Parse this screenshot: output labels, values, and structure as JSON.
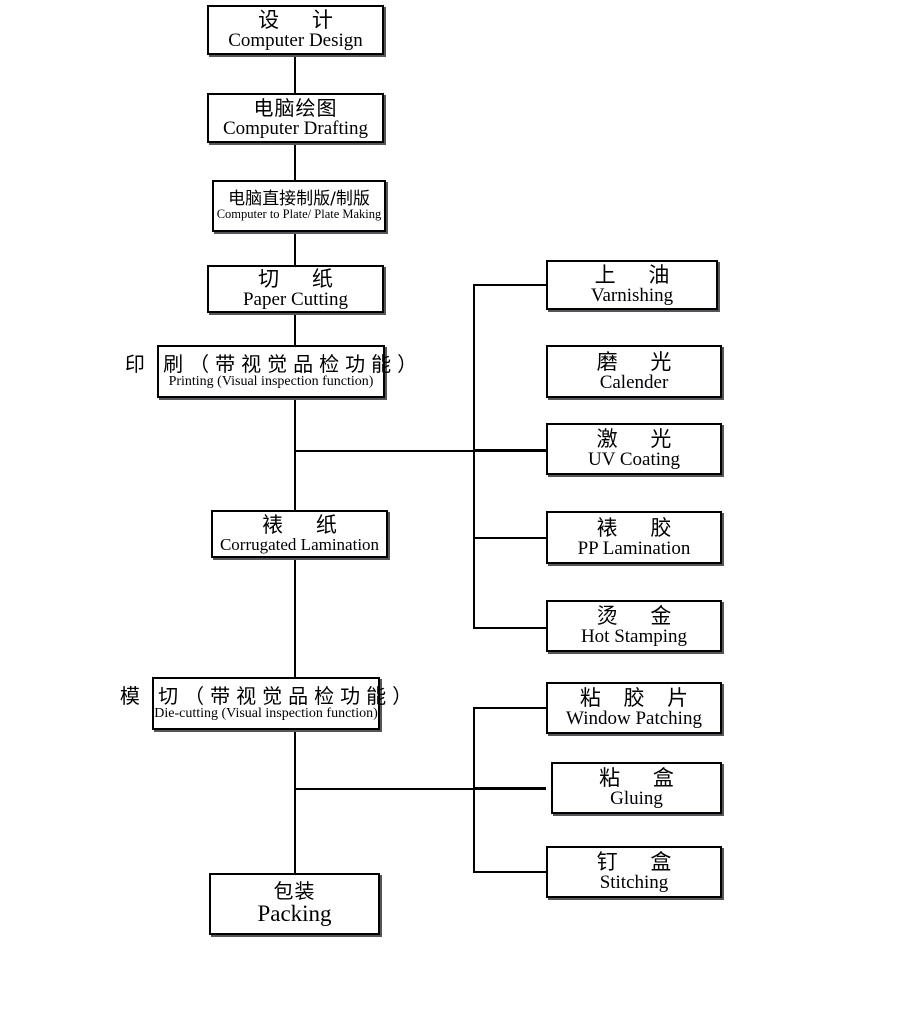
{
  "diagram": {
    "title": "Printing Production Process Flow",
    "line_color": "#000000",
    "box_border_color": "#000000",
    "box_fill_color": "#ffffff",
    "box_shadow_color": "#55555a"
  },
  "main_flow": [
    {
      "id": "computer-design",
      "cn": "设  计",
      "en": "Computer Design"
    },
    {
      "id": "computer-drafting",
      "cn": "电脑绘图",
      "en": "Computer Drafting"
    },
    {
      "id": "ctp-plate-making",
      "cn": "电脑直接制版/制版",
      "en": "Computer to Plate/ Plate Making"
    },
    {
      "id": "paper-cutting",
      "cn": "切  纸",
      "en": "Paper Cutting"
    },
    {
      "id": "printing",
      "cn": "印  刷（带视觉品检功能）",
      "en": "Printing (Visual inspection function)"
    },
    {
      "id": "corrugated-lamination",
      "cn": "裱  纸",
      "en": "Corrugated Lamination"
    },
    {
      "id": "die-cutting",
      "cn": "模  切（带视觉品检功能）",
      "en": "Die-cutting (Visual inspection function)"
    },
    {
      "id": "packing",
      "cn": "包装",
      "en": "Packing"
    }
  ],
  "branch_group_upper": [
    {
      "id": "varnishing",
      "cn": "上  油",
      "en": "Varnishing",
      "connected": true
    },
    {
      "id": "calender",
      "cn": "磨  光",
      "en": "Calender",
      "connected": false
    },
    {
      "id": "uv-coating",
      "cn": "激  光",
      "en": "UV Coating",
      "connected": true
    },
    {
      "id": "pp-lamination",
      "cn": "裱  胶",
      "en": "PP Lamination",
      "connected": true
    },
    {
      "id": "hot-stamping",
      "cn": "烫  金",
      "en": "Hot Stamping",
      "connected": true
    }
  ],
  "branch_group_lower": [
    {
      "id": "window-patching",
      "cn": "粘 胶 片",
      "en": "Window Patching",
      "connected": true
    },
    {
      "id": "gluing",
      "cn": "粘  盒",
      "en": "Gluing",
      "connected": true
    },
    {
      "id": "stitching",
      "cn": "钉  盒",
      "en": "Stitching",
      "connected": true
    }
  ]
}
